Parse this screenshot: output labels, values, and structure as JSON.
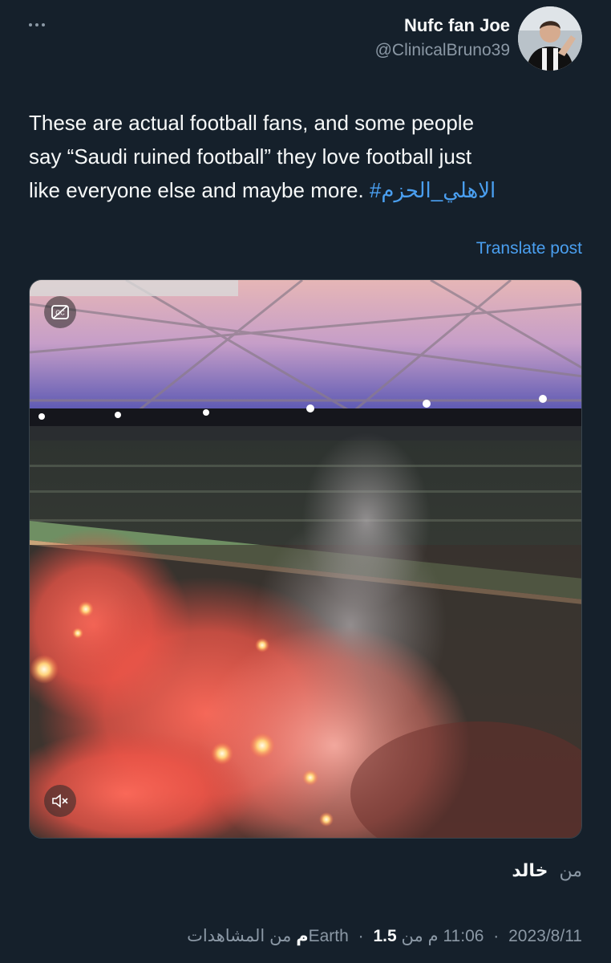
{
  "author": {
    "display_name": "Nufc fan Joe",
    "handle": "@ClinicalBruno39"
  },
  "tweet": {
    "text_line1": "These are actual football fans, and some people",
    "text_line2": "say “Saudi ruined football” they love football just",
    "text_line3": "like everyone else and maybe more.",
    "hashtag": "#الاهلي_الحزم"
  },
  "translate_label": "Translate post",
  "media": {
    "type": "video",
    "cc_icon": "closed-captions-off-icon",
    "mute_icon": "speaker-muted-icon"
  },
  "from_line": {
    "label": "من",
    "name": "خالد"
  },
  "meta": {
    "date": "2023/8/11",
    "time": "11:06 م من Earth",
    "views_count": "1.5م",
    "views_label": "من المشاهدات"
  },
  "colors": {
    "background": "#15202b",
    "text": "#f7f9f9",
    "muted": "#8b98a5",
    "link": "#4a9ff0"
  }
}
